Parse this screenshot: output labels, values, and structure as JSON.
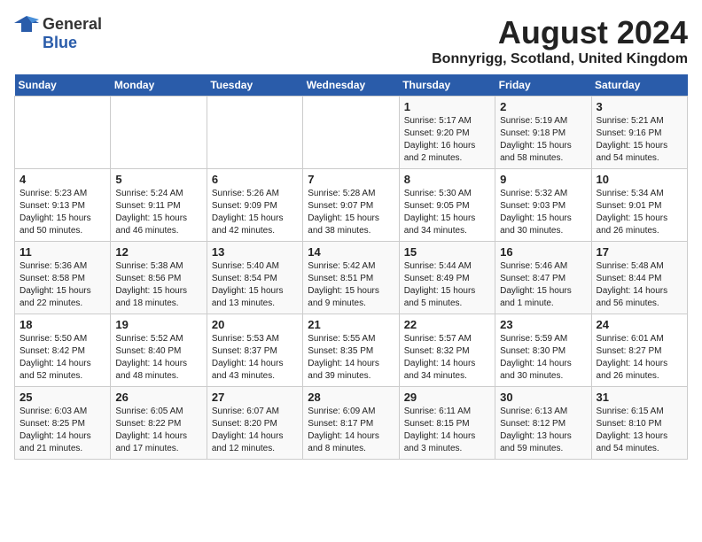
{
  "header": {
    "logo_general": "General",
    "logo_blue": "Blue",
    "title": "August 2024",
    "subtitle": "Bonnyrigg, Scotland, United Kingdom"
  },
  "columns": [
    "Sunday",
    "Monday",
    "Tuesday",
    "Wednesday",
    "Thursday",
    "Friday",
    "Saturday"
  ],
  "weeks": [
    [
      {
        "day": "",
        "info": ""
      },
      {
        "day": "",
        "info": ""
      },
      {
        "day": "",
        "info": ""
      },
      {
        "day": "",
        "info": ""
      },
      {
        "day": "1",
        "info": "Sunrise: 5:17 AM\nSunset: 9:20 PM\nDaylight: 16 hours\nand 2 minutes."
      },
      {
        "day": "2",
        "info": "Sunrise: 5:19 AM\nSunset: 9:18 PM\nDaylight: 15 hours\nand 58 minutes."
      },
      {
        "day": "3",
        "info": "Sunrise: 5:21 AM\nSunset: 9:16 PM\nDaylight: 15 hours\nand 54 minutes."
      }
    ],
    [
      {
        "day": "4",
        "info": "Sunrise: 5:23 AM\nSunset: 9:13 PM\nDaylight: 15 hours\nand 50 minutes."
      },
      {
        "day": "5",
        "info": "Sunrise: 5:24 AM\nSunset: 9:11 PM\nDaylight: 15 hours\nand 46 minutes."
      },
      {
        "day": "6",
        "info": "Sunrise: 5:26 AM\nSunset: 9:09 PM\nDaylight: 15 hours\nand 42 minutes."
      },
      {
        "day": "7",
        "info": "Sunrise: 5:28 AM\nSunset: 9:07 PM\nDaylight: 15 hours\nand 38 minutes."
      },
      {
        "day": "8",
        "info": "Sunrise: 5:30 AM\nSunset: 9:05 PM\nDaylight: 15 hours\nand 34 minutes."
      },
      {
        "day": "9",
        "info": "Sunrise: 5:32 AM\nSunset: 9:03 PM\nDaylight: 15 hours\nand 30 minutes."
      },
      {
        "day": "10",
        "info": "Sunrise: 5:34 AM\nSunset: 9:01 PM\nDaylight: 15 hours\nand 26 minutes."
      }
    ],
    [
      {
        "day": "11",
        "info": "Sunrise: 5:36 AM\nSunset: 8:58 PM\nDaylight: 15 hours\nand 22 minutes."
      },
      {
        "day": "12",
        "info": "Sunrise: 5:38 AM\nSunset: 8:56 PM\nDaylight: 15 hours\nand 18 minutes."
      },
      {
        "day": "13",
        "info": "Sunrise: 5:40 AM\nSunset: 8:54 PM\nDaylight: 15 hours\nand 13 minutes."
      },
      {
        "day": "14",
        "info": "Sunrise: 5:42 AM\nSunset: 8:51 PM\nDaylight: 15 hours\nand 9 minutes."
      },
      {
        "day": "15",
        "info": "Sunrise: 5:44 AM\nSunset: 8:49 PM\nDaylight: 15 hours\nand 5 minutes."
      },
      {
        "day": "16",
        "info": "Sunrise: 5:46 AM\nSunset: 8:47 PM\nDaylight: 15 hours\nand 1 minute."
      },
      {
        "day": "17",
        "info": "Sunrise: 5:48 AM\nSunset: 8:44 PM\nDaylight: 14 hours\nand 56 minutes."
      }
    ],
    [
      {
        "day": "18",
        "info": "Sunrise: 5:50 AM\nSunset: 8:42 PM\nDaylight: 14 hours\nand 52 minutes."
      },
      {
        "day": "19",
        "info": "Sunrise: 5:52 AM\nSunset: 8:40 PM\nDaylight: 14 hours\nand 48 minutes."
      },
      {
        "day": "20",
        "info": "Sunrise: 5:53 AM\nSunset: 8:37 PM\nDaylight: 14 hours\nand 43 minutes."
      },
      {
        "day": "21",
        "info": "Sunrise: 5:55 AM\nSunset: 8:35 PM\nDaylight: 14 hours\nand 39 minutes."
      },
      {
        "day": "22",
        "info": "Sunrise: 5:57 AM\nSunset: 8:32 PM\nDaylight: 14 hours\nand 34 minutes."
      },
      {
        "day": "23",
        "info": "Sunrise: 5:59 AM\nSunset: 8:30 PM\nDaylight: 14 hours\nand 30 minutes."
      },
      {
        "day": "24",
        "info": "Sunrise: 6:01 AM\nSunset: 8:27 PM\nDaylight: 14 hours\nand 26 minutes."
      }
    ],
    [
      {
        "day": "25",
        "info": "Sunrise: 6:03 AM\nSunset: 8:25 PM\nDaylight: 14 hours\nand 21 minutes."
      },
      {
        "day": "26",
        "info": "Sunrise: 6:05 AM\nSunset: 8:22 PM\nDaylight: 14 hours\nand 17 minutes."
      },
      {
        "day": "27",
        "info": "Sunrise: 6:07 AM\nSunset: 8:20 PM\nDaylight: 14 hours\nand 12 minutes."
      },
      {
        "day": "28",
        "info": "Sunrise: 6:09 AM\nSunset: 8:17 PM\nDaylight: 14 hours\nand 8 minutes."
      },
      {
        "day": "29",
        "info": "Sunrise: 6:11 AM\nSunset: 8:15 PM\nDaylight: 14 hours\nand 3 minutes."
      },
      {
        "day": "30",
        "info": "Sunrise: 6:13 AM\nSunset: 8:12 PM\nDaylight: 13 hours\nand 59 minutes."
      },
      {
        "day": "31",
        "info": "Sunrise: 6:15 AM\nSunset: 8:10 PM\nDaylight: 13 hours\nand 54 minutes."
      }
    ]
  ]
}
